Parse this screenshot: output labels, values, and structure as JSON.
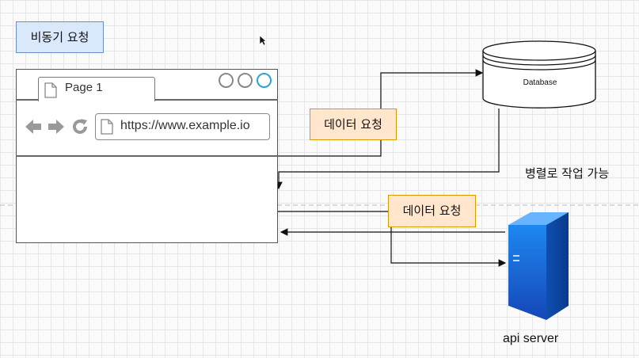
{
  "title": "비동기 요청",
  "browser": {
    "tab_label": "Page 1",
    "url": "https://www.example.io"
  },
  "requests": {
    "db_request_label": "데이터 요청",
    "api_request_label": "데이터 요청"
  },
  "database": {
    "label": "Database"
  },
  "parallel_label": "병렬로 작업 가능",
  "api_server": {
    "label": "api server"
  },
  "colors": {
    "title_fill": "#dae8fc",
    "request_fill": "#ffe6cc",
    "server_blue": "#1a73e8",
    "active_window_button": "#2aa3d6"
  }
}
